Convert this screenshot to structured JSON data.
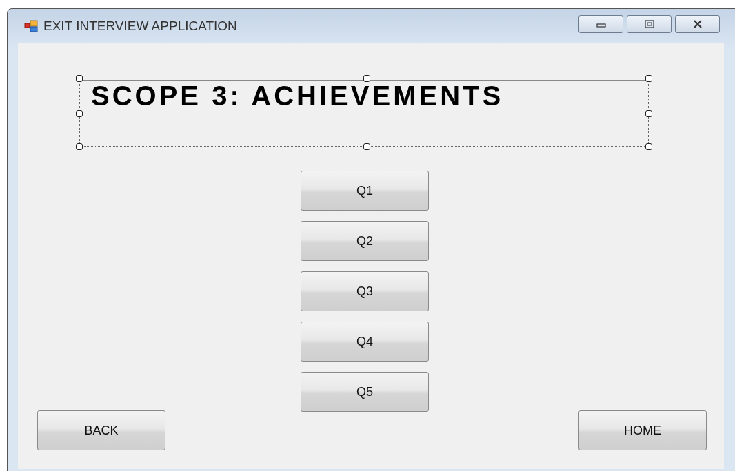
{
  "window": {
    "title": "EXIT INTERVIEW APPLICATION"
  },
  "heading": {
    "text": "SCOPE 3: ACHIEVEMENTS",
    "selected": true
  },
  "question_buttons": [
    "Q1",
    "Q2",
    "Q3",
    "Q4",
    "Q5"
  ],
  "nav_buttons": {
    "back": "BACK",
    "home": "HOME"
  }
}
